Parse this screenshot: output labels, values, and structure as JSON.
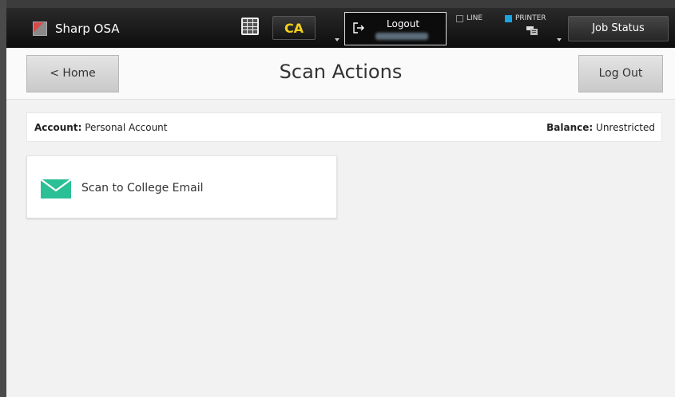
{
  "header": {
    "app_title": "Sharp OSA",
    "ca_label": "CA",
    "logout_label": "Logout",
    "line_label": "LINE",
    "printer_label": "PRINTER",
    "job_status_label": "Job Status",
    "printer_indicator_color": "#1aa4e0",
    "ca_color": "#f3d11a"
  },
  "title_row": {
    "home_label": "< Home",
    "page_title": "Scan Actions",
    "logout_button_label": "Log Out"
  },
  "account": {
    "account_key": "Account:",
    "account_value": "Personal Account",
    "balance_key": "Balance:",
    "balance_value": "Unrestricted"
  },
  "actions": [
    {
      "label": "Scan to College Email",
      "icon": "envelope-icon",
      "icon_color": "#2bbf95"
    }
  ]
}
